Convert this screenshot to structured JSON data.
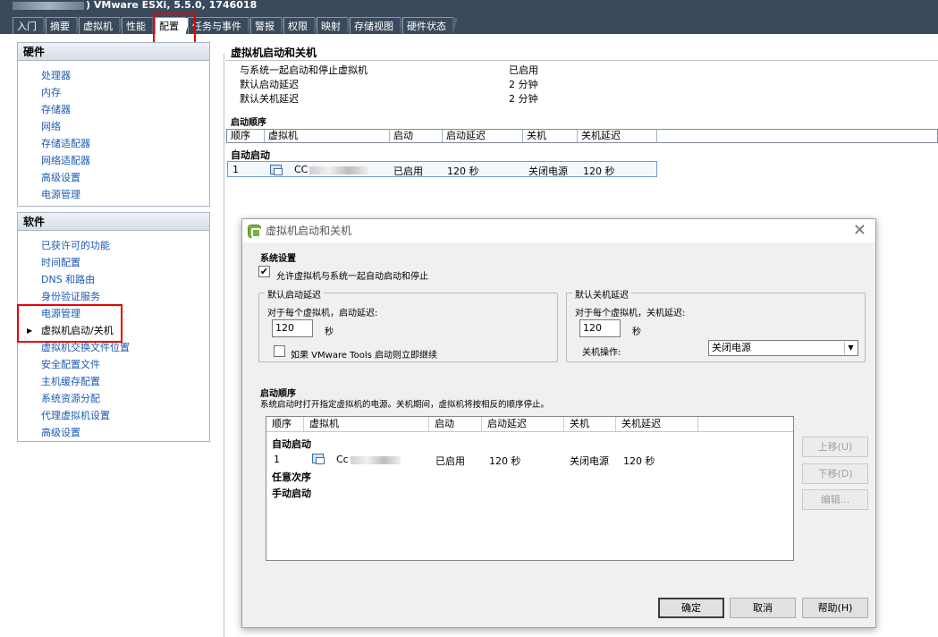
{
  "header": {
    "title": "VMware ESXi, 5.5.0, 1746018",
    "title_prefix": ")",
    "tabs": [
      "入门",
      "摘要",
      "虚拟机",
      "性能",
      "配置",
      "任务与事件",
      "警报",
      "权限",
      "映射",
      "存储视图",
      "硬件状态"
    ],
    "active_tab": "配置"
  },
  "nav": {
    "hardware_title": "硬件",
    "hardware_items": [
      "处理器",
      "内存",
      "存储器",
      "网络",
      "存储适配器",
      "网络适配器",
      "高级设置",
      "电源管理"
    ],
    "software_title": "软件",
    "software_items": [
      "已获许可的功能",
      "时间配置",
      "DNS 和路由",
      "身份验证服务",
      "电源管理",
      "虚拟机启动/关机",
      "虚拟机交换文件位置",
      "安全配置文件",
      "主机缓存配置",
      "系统资源分配",
      "代理虚拟机设置",
      "高级设置"
    ],
    "current_item": "虚拟机启动/关机"
  },
  "main": {
    "title": "虚拟机启动和关机",
    "settings": [
      {
        "label": "与系统一起启动和停止虚拟机",
        "value": "已启用"
      },
      {
        "label": "默认启动延迟",
        "value": "2 分钟"
      },
      {
        "label": "默认关机延迟",
        "value": "2 分钟"
      }
    ],
    "order_title": "启动顺序",
    "columns": [
      "顺序",
      "虚拟机",
      "启动",
      "启动延迟",
      "关机",
      "关机延迟"
    ],
    "group_auto": "自动启动",
    "row": {
      "order": "1",
      "vm": "CC",
      "start": "已启用",
      "start_delay": "120 秒",
      "shutdown": "关闭电源",
      "shutdown_delay": "120 秒"
    }
  },
  "dialog": {
    "title": "虚拟机启动和关机",
    "system_settings": "系统设置",
    "allow_label": "允许虚拟机与系统一起自动启动和停止",
    "allow_checked": true,
    "start_group": "默认启动延迟",
    "start_desc": "对于每个虚拟机，启动延迟:",
    "start_value": "120",
    "unit": "秒",
    "tools_label": "如果 VMware Tools 启动则立即继续",
    "tools_checked": false,
    "stop_group": "默认关机延迟",
    "stop_desc": "对于每个虚拟机，关机延迟:",
    "stop_value": "120",
    "action_label": "关机操作:",
    "action_value": "关闭电源",
    "order_title": "启动顺序",
    "order_desc": "系统启动时打开指定虚拟机的电源。关机期间，虚拟机将按相反的顺序停止。",
    "columns": [
      "顺序",
      "虚拟机",
      "启动",
      "启动延迟",
      "关机",
      "关机延迟"
    ],
    "group_auto": "自动启动",
    "row": {
      "order": "1",
      "vm": "Cc",
      "start": "已启用",
      "start_delay": "120 秒",
      "shutdown": "关闭电源",
      "shutdown_delay": "120 秒"
    },
    "group_any": "任意次序",
    "group_manual": "手动启动",
    "btn_up": "上移(U)",
    "btn_down": "下移(D)",
    "btn_edit": "编辑...",
    "btn_ok": "确定",
    "btn_cancel": "取消",
    "btn_help": "帮助(H)"
  }
}
